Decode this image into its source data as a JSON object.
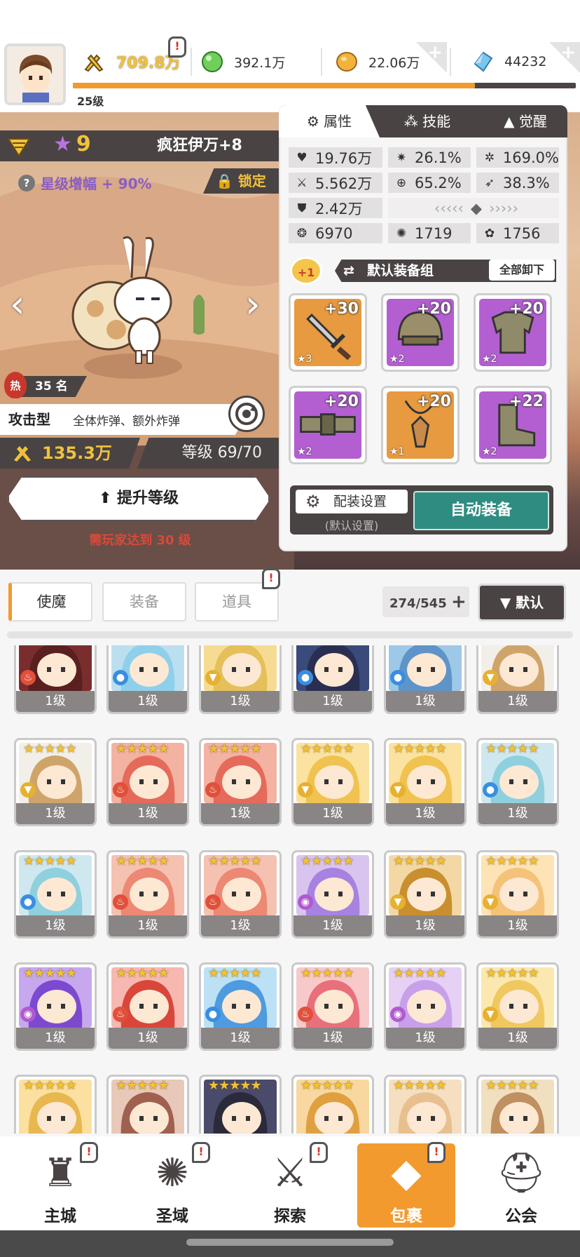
{
  "player": {
    "level": "25级"
  },
  "resources": {
    "power": "709.8万",
    "green_gem": "392.1万",
    "gold": "22.06万",
    "crystal": "44232"
  },
  "hero": {
    "star": "9",
    "name": "疯狂伊万+8",
    "star_bonus": "星级增幅 + 90%",
    "lock_label": "锁定",
    "hot_rank": "35 名",
    "hot_label": "热",
    "type": "攻击型",
    "type_desc": "全体炸弹、额外炸弹",
    "power": "135.3万",
    "level": "等级 69/70",
    "upgrade_label": "提升等级",
    "requirement": "需玩家达到 30 级"
  },
  "panel": {
    "tabs": [
      "属性",
      "技能",
      "觉醒"
    ],
    "stats": {
      "hp": "19.76万",
      "crit": "26.1%",
      "crit_dmg": "169.0%",
      "atk": "5.562万",
      "acc": "65.2%",
      "spd": "38.3%",
      "def": "2.42万",
      "v1": "6970",
      "v2": "1719",
      "v3": "1756"
    },
    "equip_badge": "+1",
    "equip_set": "默认装备组",
    "unequip_all": "全部卸下",
    "slots": [
      {
        "enh": "+30",
        "stars": "★3",
        "icon": "sword-icon",
        "color": "#e79a3f"
      },
      {
        "enh": "+20",
        "stars": "★2",
        "icon": "helmet-icon",
        "color": "#b35fd1"
      },
      {
        "enh": "+20",
        "stars": "★2",
        "icon": "armor-icon",
        "color": "#b35fd1"
      },
      {
        "enh": "+20",
        "stars": "★2",
        "icon": "belt-icon",
        "color": "#b35fd1"
      },
      {
        "enh": "+20",
        "stars": "★1",
        "icon": "necklace-icon",
        "color": "#e79a3f"
      },
      {
        "enh": "+22",
        "stars": "★2",
        "icon": "boots-icon",
        "color": "#b35fd1"
      }
    ],
    "config_label": "配装设置",
    "config_sub": "(默认设置)",
    "auto_equip": "自动装备"
  },
  "inventory": {
    "tabs": [
      "使魔",
      "装备",
      "道具"
    ],
    "count": "274/545",
    "sort_label": "▼ 默认",
    "cards": [
      {
        "lv": "1级",
        "bg": "#7a2d2d",
        "hair": "#5a1f1f",
        "el": "fire"
      },
      {
        "lv": "1级",
        "bg": "#bcdff0",
        "hair": "#8ed0ea",
        "el": "water"
      },
      {
        "lv": "1级",
        "bg": "#f6dc92",
        "hair": "#e5c05a",
        "el": "wind"
      },
      {
        "lv": "1级",
        "bg": "#3a4a7a",
        "hair": "#2a2f52",
        "el": "water"
      },
      {
        "lv": "1级",
        "bg": "#9ec8e8",
        "hair": "#5e94c8",
        "el": "water"
      },
      {
        "lv": "1级",
        "bg": "#f2efe8",
        "hair": "#cfa46b",
        "el": "wind"
      },
      {
        "lv": "1级",
        "bg": "#f2efe8",
        "hair": "#cfa46b",
        "el": "wind"
      },
      {
        "lv": "1级",
        "bg": "#f3b2a2",
        "hair": "#e56a5a",
        "el": "fire"
      },
      {
        "lv": "1级",
        "bg": "#f3b2a2",
        "hair": "#e56a5a",
        "el": "fire"
      },
      {
        "lv": "1级",
        "bg": "#fbe2a0",
        "hair": "#f0c250",
        "el": "wind"
      },
      {
        "lv": "1级",
        "bg": "#fbe2a0",
        "hair": "#f0c250",
        "el": "wind"
      },
      {
        "lv": "1级",
        "bg": "#cfe8ef",
        "hair": "#8fd0de",
        "el": "water"
      },
      {
        "lv": "1级",
        "bg": "#cfe8ef",
        "hair": "#8fd0de",
        "el": "water"
      },
      {
        "lv": "1级",
        "bg": "#f5c1b0",
        "hair": "#ec8873",
        "el": "fire"
      },
      {
        "lv": "1级",
        "bg": "#f5c1b0",
        "hair": "#ec8873",
        "el": "fire"
      },
      {
        "lv": "1级",
        "bg": "#d9c4f0",
        "hair": "#a782e0",
        "el": "dark"
      },
      {
        "lv": "1级",
        "bg": "#f3d8a6",
        "hair": "#c98f2e",
        "el": "wind"
      },
      {
        "lv": "1级",
        "bg": "#fde3b5",
        "hair": "#f5c27a",
        "el": "wind"
      },
      {
        "lv": "1级",
        "bg": "#c7a8ee",
        "hair": "#7c4ad0",
        "el": "dark"
      },
      {
        "lv": "1级",
        "bg": "#f6b8b0",
        "hair": "#d9463a",
        "el": "fire"
      },
      {
        "lv": "1级",
        "bg": "#bde1f4",
        "hair": "#4e9be0",
        "el": "water"
      },
      {
        "lv": "1级",
        "bg": "#f8c9c9",
        "hair": "#e8707a",
        "el": "fire"
      },
      {
        "lv": "1级",
        "bg": "#e6d0f4",
        "hair": "#c8a0ea",
        "el": "dark"
      },
      {
        "lv": "1级",
        "bg": "#fbe8b0",
        "hair": "#f0c860",
        "el": "wind"
      },
      {
        "lv": "",
        "bg": "#fbe0a0",
        "hair": "#e8b850",
        "el": ""
      },
      {
        "lv": "",
        "bg": "#e8c8b8",
        "hair": "#a06050",
        "el": ""
      },
      {
        "lv": "",
        "bg": "#4a4a6a",
        "hair": "#2a2a3a",
        "el": ""
      },
      {
        "lv": "",
        "bg": "#f8d8a0",
        "hair": "#e0a040",
        "el": ""
      },
      {
        "lv": "",
        "bg": "#f5dfc0",
        "hair": "#e8c090",
        "el": ""
      },
      {
        "lv": "",
        "bg": "#f0e0c0",
        "hair": "#c09060",
        "el": ""
      }
    ]
  },
  "nav": [
    {
      "label": "主城",
      "icon": "castle-icon"
    },
    {
      "label": "圣域",
      "icon": "portal-icon"
    },
    {
      "label": "探索",
      "icon": "sword-stone-icon"
    },
    {
      "label": "包裹",
      "icon": "bag-icon"
    },
    {
      "label": "公会",
      "icon": "guild-helmet-icon"
    }
  ],
  "colors": {
    "accent": "#f29a2e",
    "dark": "#4a4343",
    "teal": "#2f8c80",
    "purple": "#b35fd1"
  }
}
